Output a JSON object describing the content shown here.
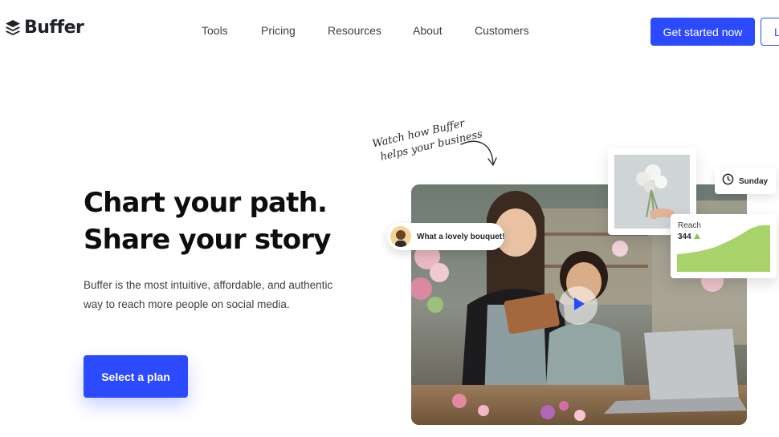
{
  "brand": {
    "name": "Buffer",
    "logo_icon": "stacked-layers-icon",
    "accent": "#2c4bff"
  },
  "nav": {
    "items": [
      {
        "label": "Tools"
      },
      {
        "label": "Pricing"
      },
      {
        "label": "Resources"
      },
      {
        "label": "About"
      },
      {
        "label": "Customers"
      }
    ],
    "cta_label": "Get started now",
    "login_label": "L"
  },
  "hero": {
    "title_line1": "Chart your path.",
    "title_line2": "Share your story",
    "description": "Buffer is the most intuitive, affordable, and authentic way to reach more people on social media.",
    "button_label": "Select a plan"
  },
  "media": {
    "handwritten_line1": "Watch how Buffer",
    "handwritten_line2": "helps your business",
    "comment_text": "What a lovely bouquet!",
    "day_label": "Sunday",
    "reach_label": "Reach",
    "reach_value": "344",
    "reach_trend": "up",
    "reach_color": "#a8d36a"
  }
}
